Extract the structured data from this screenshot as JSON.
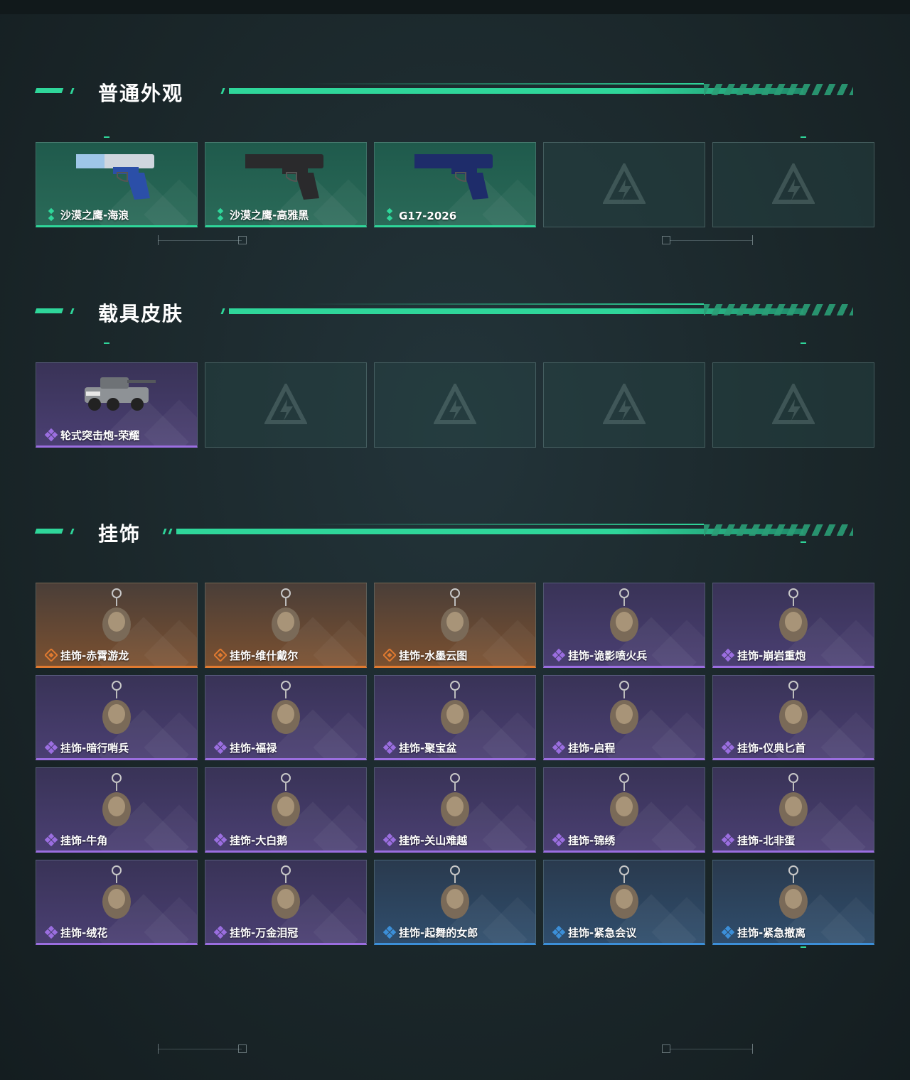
{
  "sections": [
    {
      "title": "普通外观",
      "items": [
        {
          "label": "沙漠之鹰-海浪",
          "rarity": "green",
          "icon": "blue-camo-pistol"
        },
        {
          "label": "沙漠之鹰-高雅黑",
          "rarity": "green",
          "icon": "black-pistol"
        },
        {
          "label": "G17-2026",
          "rarity": "green",
          "icon": "navy-pistol"
        },
        {
          "label": "",
          "rarity": "empty"
        },
        {
          "label": "",
          "rarity": "empty"
        }
      ]
    },
    {
      "title": "载具皮肤",
      "items": [
        {
          "label": "轮式突击炮-荣耀",
          "rarity": "purple",
          "icon": "armored-vehicle"
        },
        {
          "label": "",
          "rarity": "empty"
        },
        {
          "label": "",
          "rarity": "empty"
        },
        {
          "label": "",
          "rarity": "empty"
        },
        {
          "label": "",
          "rarity": "empty"
        }
      ]
    },
    {
      "title": "挂饰",
      "items": [
        {
          "label": "挂饰-赤霄游龙",
          "rarity": "orange",
          "icon": "charm"
        },
        {
          "label": "挂饰-维什戴尔",
          "rarity": "orange",
          "icon": "charm"
        },
        {
          "label": "挂饰-水墨云图",
          "rarity": "orange",
          "icon": "charm"
        },
        {
          "label": "挂饰-诡影喷火兵",
          "rarity": "purple",
          "icon": "charm"
        },
        {
          "label": "挂饰-崩岩重炮",
          "rarity": "purple",
          "icon": "charm"
        },
        {
          "label": "挂饰-暗行哨兵",
          "rarity": "purple",
          "icon": "charm"
        },
        {
          "label": "挂饰-福禄",
          "rarity": "purple",
          "icon": "charm"
        },
        {
          "label": "挂饰-聚宝盆",
          "rarity": "purple",
          "icon": "charm"
        },
        {
          "label": "挂饰-启程",
          "rarity": "purple",
          "icon": "charm"
        },
        {
          "label": "挂饰-仪典匕首",
          "rarity": "purple",
          "icon": "charm"
        },
        {
          "label": "挂饰-牛角",
          "rarity": "purple",
          "icon": "charm"
        },
        {
          "label": "挂饰-大白鹅",
          "rarity": "purple",
          "icon": "charm"
        },
        {
          "label": "挂饰-关山难越",
          "rarity": "purple",
          "icon": "charm"
        },
        {
          "label": "挂饰-锦绣",
          "rarity": "purple",
          "icon": "charm"
        },
        {
          "label": "挂饰-北非蛋",
          "rarity": "purple",
          "icon": "charm"
        },
        {
          "label": "挂饰-绒花",
          "rarity": "purple",
          "icon": "charm"
        },
        {
          "label": "挂饰-万金泪冠",
          "rarity": "purple",
          "icon": "charm"
        },
        {
          "label": "挂饰-起舞的女郎",
          "rarity": "blue",
          "icon": "charm"
        },
        {
          "label": "挂饰-紧急会议",
          "rarity": "blue",
          "icon": "charm"
        },
        {
          "label": "挂饰-紧急撤离",
          "rarity": "blue",
          "icon": "charm"
        }
      ]
    }
  ],
  "colors": {
    "accent": "#2fd69a",
    "green": "#2fd69a",
    "purple": "#9b6ee0",
    "orange": "#e07a30",
    "blue": "#3c8fd8"
  }
}
